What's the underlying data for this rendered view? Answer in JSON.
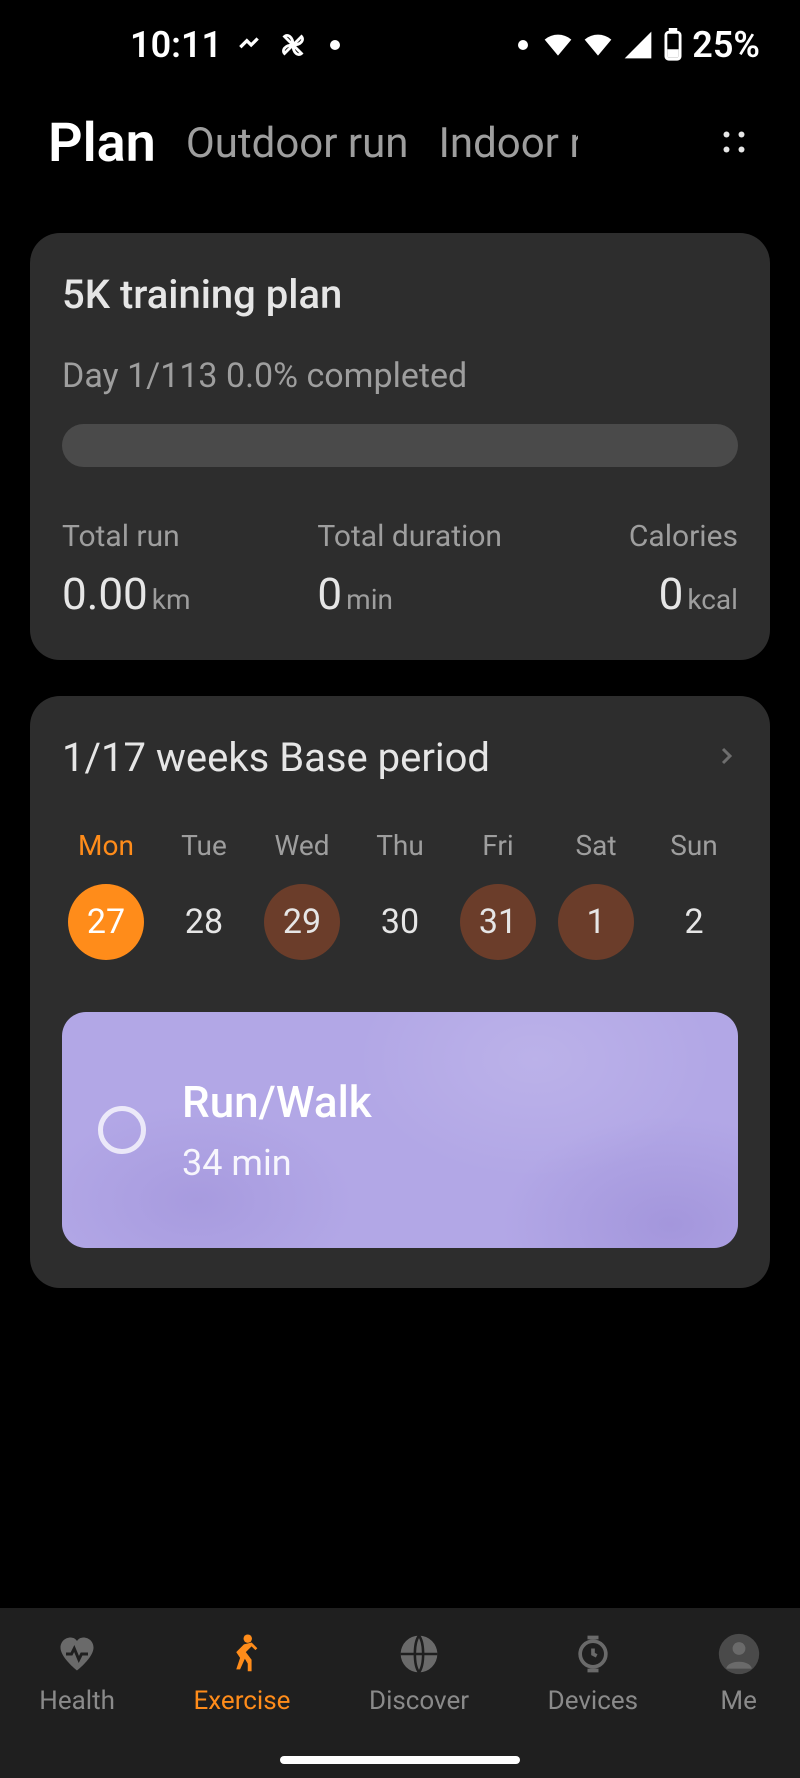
{
  "status": {
    "time": "10:11",
    "battery": "25%"
  },
  "tabs": {
    "items": [
      "Plan",
      "Outdoor run",
      "Indoor r"
    ],
    "active_index": 0
  },
  "plan_card": {
    "title": "5K training plan",
    "subtitle": "Day 1/113 0.0% completed",
    "stats": [
      {
        "label": "Total run",
        "value": "0.00",
        "unit": "km"
      },
      {
        "label": "Total duration",
        "value": "0",
        "unit": "min"
      },
      {
        "label": "Calories",
        "value": "0",
        "unit": "kcal"
      }
    ]
  },
  "week_card": {
    "title": "1/17 weeks Base period",
    "days": [
      {
        "label": "Mon",
        "num": "27",
        "state": "selected"
      },
      {
        "label": "Tue",
        "num": "28",
        "state": "none"
      },
      {
        "label": "Wed",
        "num": "29",
        "state": "scheduled"
      },
      {
        "label": "Thu",
        "num": "30",
        "state": "none"
      },
      {
        "label": "Fri",
        "num": "31",
        "state": "scheduled"
      },
      {
        "label": "Sat",
        "num": "1",
        "state": "scheduled"
      },
      {
        "label": "Sun",
        "num": "2",
        "state": "none"
      }
    ],
    "workout": {
      "title": "Run/Walk",
      "subtitle": "34 min"
    }
  },
  "bottom_nav": {
    "items": [
      {
        "label": "Health",
        "icon": "heart-icon"
      },
      {
        "label": "Exercise",
        "icon": "runner-icon"
      },
      {
        "label": "Discover",
        "icon": "globe-icon"
      },
      {
        "label": "Devices",
        "icon": "watch-icon"
      },
      {
        "label": "Me",
        "icon": "user-icon"
      }
    ],
    "active_index": 1
  },
  "colors": {
    "accent": "#ff8c1a",
    "card": "#2d2d2d",
    "workout_tile": "#b2a7e6"
  }
}
